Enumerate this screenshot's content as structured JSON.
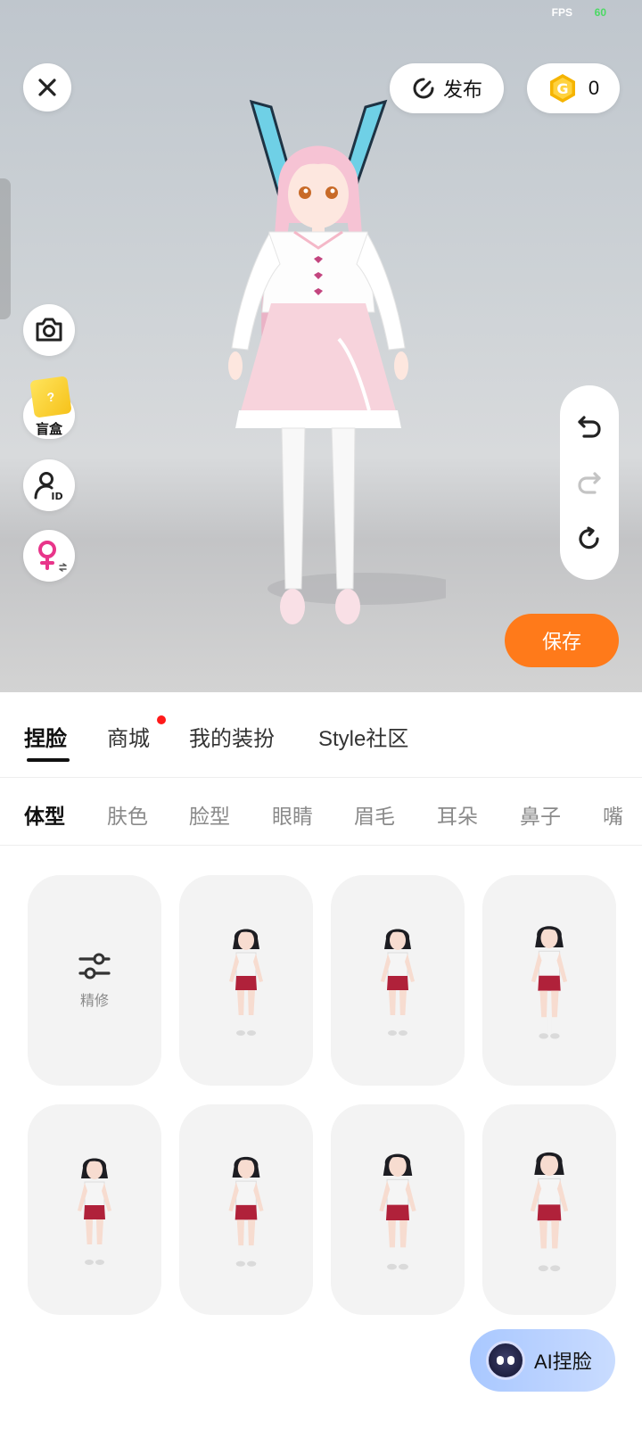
{
  "status": {
    "fps_label": "FPS",
    "fps_value": "60"
  },
  "top": {
    "close_icon": "close-icon",
    "publish_label": "发布",
    "publish_icon": "publish-icon",
    "coins": "0",
    "coin_icon": "coin-icon"
  },
  "left_tools": {
    "camera_icon": "camera-icon",
    "blind_box_label": "盲盒",
    "blind_box_mark": "?",
    "id_icon": "user-id-icon",
    "gender_icon": "female-swap-icon"
  },
  "history": {
    "undo_icon": "undo-icon",
    "redo_icon": "redo-icon",
    "reset_icon": "reset-icon"
  },
  "save_label": "保存",
  "main_tabs": [
    "捏脸",
    "商城",
    "我的装扮",
    "Style社区"
  ],
  "main_tab_active": "捏脸",
  "sub_tabs": [
    "体型",
    "肤色",
    "脸型",
    "眼睛",
    "眉毛",
    "耳朵",
    "鼻子",
    "嘴"
  ],
  "sub_tab_active": "体型",
  "grid": {
    "refine_label": "精修",
    "refine_icon": "sliders-icon"
  },
  "ai_button_label": "AI捏脸",
  "colors": {
    "accent": "#ff7a1a",
    "badge": "#ff1a1a",
    "ai_button": "#b5cfff"
  }
}
